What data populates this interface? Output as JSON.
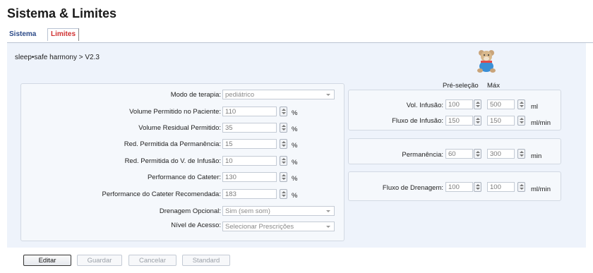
{
  "header": {
    "title": "Sistema & Limites"
  },
  "tabs": [
    {
      "label": "Sistema",
      "active": false
    },
    {
      "label": "Limites",
      "active": true
    }
  ],
  "breadcrumb": "sleep•safe harmony > V2.3",
  "left_form": {
    "therapy_mode": {
      "label": "Modo de terapia:",
      "value": "pediátrico"
    },
    "numeric_fields": [
      {
        "label": "Volume Permitido no Paciente:",
        "value": "110",
        "unit": "%"
      },
      {
        "label": "Volume Residual Permitido:",
        "value": "35",
        "unit": "%"
      },
      {
        "label": "Red. Permitida da Permanência:",
        "value": "15",
        "unit": "%"
      },
      {
        "label": "Red. Permitida do V. de Infusão:",
        "value": "10",
        "unit": "%"
      },
      {
        "label": "Performance do Cateter:",
        "value": "130",
        "unit": "%"
      },
      {
        "label": "Performance do Cateter Recomendada:",
        "value": "183",
        "unit": "%"
      }
    ],
    "optional_drainage": {
      "label": "Drenagem Opcional:",
      "value": "Sim (sem som)"
    },
    "access_level": {
      "label": "Nível de Acesso:",
      "value": "Selecionar Prescrições"
    }
  },
  "right_form": {
    "col_preselect": "Pré-seleção",
    "col_max": "Máx",
    "infusion": [
      {
        "label": "Vol. Infusão:",
        "pre": "100",
        "max": "500",
        "unit": "ml"
      },
      {
        "label": "Fluxo de Infusão:",
        "pre": "150",
        "max": "150",
        "unit": "ml/min"
      }
    ],
    "dwell": {
      "label": "Permanência:",
      "pre": "60",
      "max": "300",
      "unit": "min"
    },
    "drain": {
      "label": "Fluxo de Drenagem:",
      "pre": "100",
      "max": "100",
      "unit": "ml/min"
    }
  },
  "buttons": {
    "edit": "Editar",
    "save": "Guardar",
    "cancel": "Cancelar",
    "standard": "Standard"
  },
  "icons": {
    "mascot": "teddy-bear-icon"
  }
}
